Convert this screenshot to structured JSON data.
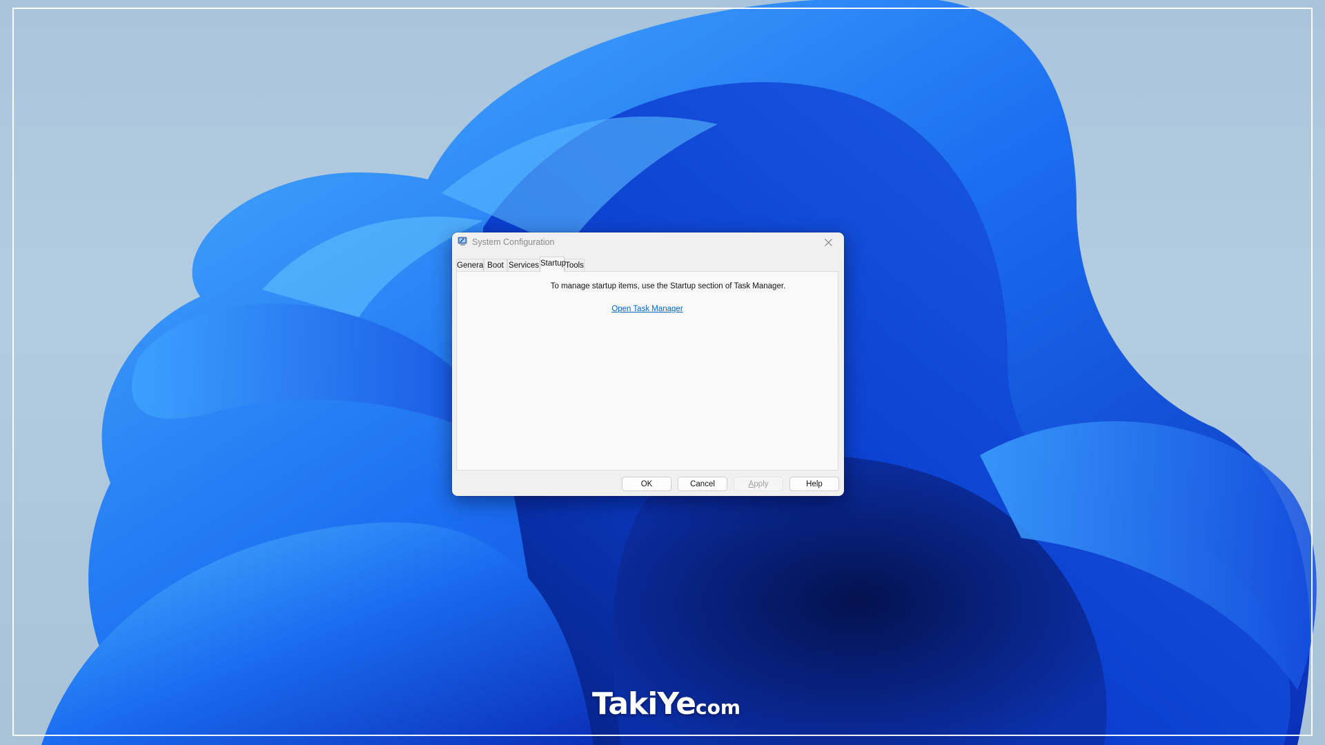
{
  "window": {
    "title": "System Configuration",
    "close_icon": "close-icon",
    "app_icon": "system-configuration-icon"
  },
  "tabs": [
    {
      "label": "General",
      "selected": false
    },
    {
      "label": "Boot",
      "selected": false
    },
    {
      "label": "Services",
      "selected": false
    },
    {
      "label": "Startup",
      "selected": true
    },
    {
      "label": "Tools",
      "selected": false
    }
  ],
  "startup_panel": {
    "message": "To manage startup items, use the Startup section of Task Manager.",
    "link_label": "Open Task Manager"
  },
  "buttons": {
    "ok": "OK",
    "cancel": "Cancel",
    "apply_prefix": "",
    "apply_mnemonic": "A",
    "apply_rest": "pply",
    "apply_enabled": false,
    "help": "Help"
  },
  "watermark": {
    "main": "TakiYe",
    "suffix": "com"
  },
  "colors": {
    "link": "#0066cc",
    "dialog_bg": "#f0f0f0",
    "panel_bg": "#f9f9f9",
    "wallpaper_blue": "#1a6cf0"
  }
}
